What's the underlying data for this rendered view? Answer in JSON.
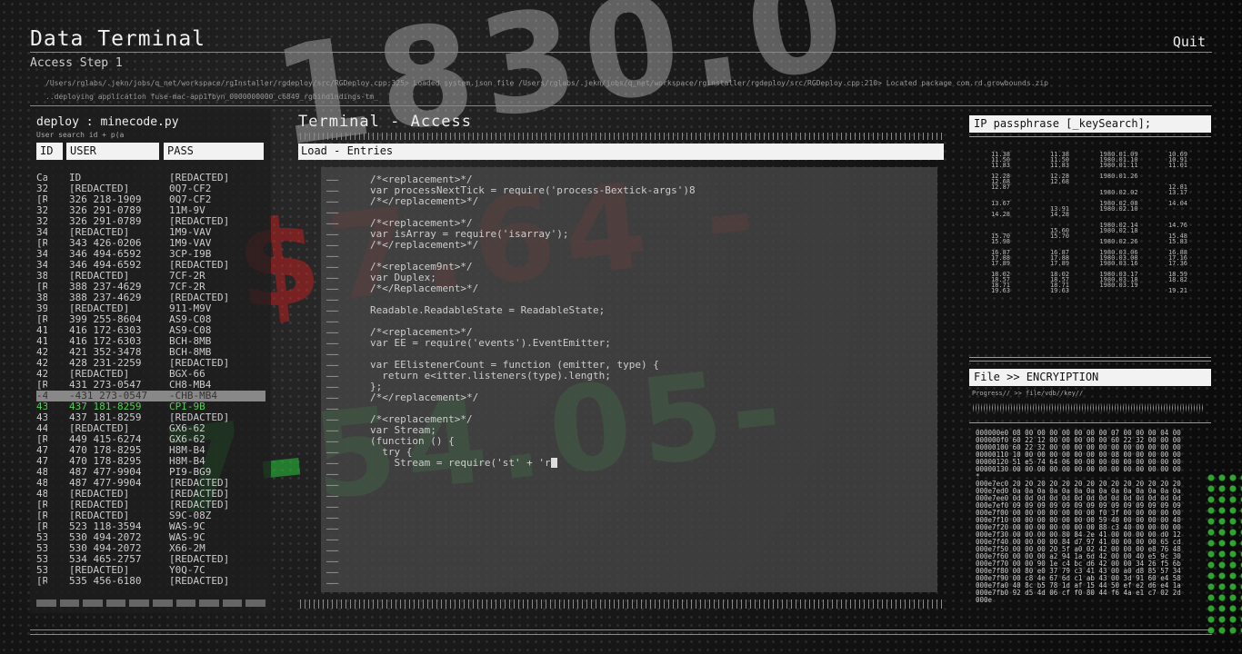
{
  "header": {
    "title": "Data Terminal",
    "quit": "Quit",
    "step": "Access Step 1",
    "path_1": "/Users/rglabs/.jekn/jobs/q_net/workspace/rgInstaller/rgdeploy/src/RGDeploy.cpp:325> Loaded system.json file /Users/rglabs/.jekn/jobs/q_net/workspace/rginstaller/rgdeploy/src/RGDeploy.cpp:210> Located package com.rd.growbounds.zip",
    "path_2": "..deploying application fuse-mac-app1fbyn_0000000000_c6849_rgbindindings-tm_"
  },
  "left_panel": {
    "title": "deploy : minecode.py",
    "subtitle": "User search id + p(a",
    "col_id": "ID",
    "col_user": "USER",
    "col_pass": "PASS",
    "rows": [
      [
        "Ca",
        "ID",
        "[REDACTED]"
      ],
      [
        "32",
        "[REDACTED]",
        "0Q7-CF2"
      ],
      [
        "[R",
        "326 218-1909",
        "0Q7-CF2"
      ],
      [
        "32",
        "326 291-0789",
        "11M-9V"
      ],
      [
        "32",
        "326 291-0789",
        "[REDACTED]"
      ],
      [
        "34",
        "[REDACTED]",
        "1M9-VAV"
      ],
      [
        "[R",
        "343 426-0206",
        "1M9-VAV"
      ],
      [
        "34",
        "346 494-6592",
        "3CP-I9B"
      ],
      [
        "34",
        "346 494-6592",
        "[REDACTED]"
      ],
      [
        "38",
        "[REDACTED]",
        "7CF-2R"
      ],
      [
        "[R",
        "388 237-4629",
        "7CF-2R"
      ],
      [
        "38",
        "388 237-4629",
        "[REDACTED]"
      ],
      [
        "39",
        "[REDACTED]",
        "911-M9V"
      ],
      [
        "[R",
        "399 255-8604",
        "AS9-C08"
      ],
      [
        "41",
        "416 172-6303",
        "AS9-C08"
      ],
      [
        "41",
        "416 172-6303",
        "BCH-8MB"
      ],
      [
        "42",
        "421 352-3478",
        "BCH-8MB"
      ],
      [
        "42",
        "428 231-2259",
        "[REDACTED]"
      ],
      [
        "42",
        "[REDACTED]",
        "BGX-66"
      ],
      [
        "[R",
        "431 273-0547",
        "CH8-MB4"
      ],
      [
        "-4",
        "-431 273-0547",
        "-CHB-MB4"
      ],
      [
        "43",
        "437 181-8259",
        "CPI-9B"
      ],
      [
        "43",
        "437 181-8259",
        "[REDACTED]"
      ],
      [
        "44",
        "[REDACTED]",
        "GX6-62"
      ],
      [
        "[R",
        "449 415-6274",
        "GX6-62"
      ],
      [
        "47",
        "470 178-8295",
        "H8M-B4"
      ],
      [
        "47",
        "470 178-8295",
        "H8M-B4"
      ],
      [
        "48",
        "487 477-9904",
        "PI9-BG9"
      ],
      [
        "48",
        "487 477-9904",
        "[REDACTED]"
      ],
      [
        "48",
        "[REDACTED]",
        "[REDACTED]"
      ],
      [
        "[R",
        "[REDACTED]",
        "[REDACTED]"
      ],
      [
        "[R",
        "[REDACTED]",
        "S9C-08Z"
      ],
      [
        "[R",
        "523 118-3594",
        "WAS-9C"
      ],
      [
        "53",
        "530 494-2072",
        "WAS-9C"
      ],
      [
        "53",
        "530 494-2072",
        "X66-2M"
      ],
      [
        "53",
        "534 465-2757",
        "[REDACTED]"
      ],
      [
        "53",
        "[REDACTED]",
        "Y0Q-7C"
      ],
      [
        "[R",
        "535 456-6180",
        "[REDACTED]"
      ]
    ]
  },
  "terminal": {
    "title": "Terminal - Access",
    "load_label": "Load - Entries",
    "gutter": "——",
    "lines": [
      "/*<replacement>*/",
      "var processNextTick = require('process-Bextick-args')8",
      "/*</replacement>*/",
      "",
      "/*<replacement>*/",
      "var isArray = require('isarray');",
      "/*</replacement>*/",
      "",
      "/*<replacem9nt>*/",
      "var Duplex;",
      "/*</Replacement>*/",
      "",
      "Readable.ReadableState = ReadableState;",
      "",
      "/*<replacement>*/",
      "var EE = require('events').EventEmitter;",
      "",
      "var EElistenerCount = function (emitter, type) {",
      "  return e<itter.listeners(type).length;",
      "};",
      "/*</replacement>*/",
      "",
      "/*<replacement>*/",
      "var Stream;",
      "(function () {",
      "  try {",
      "    Stream = require('st' + 'r",
      "",
      "",
      "",
      "",
      "",
      "",
      "",
      "",
      "",
      "",
      ""
    ]
  },
  "right_panel": {
    "ip_label": "IP passphrase [_keySearch];",
    "stats": [
      [
        "11.38",
        "11.38",
        "1980.01.09",
        "10.69"
      ],
      [
        "11.50",
        "11.50",
        "1980.01.10",
        "10.91"
      ],
      [
        "11.83",
        "11.83",
        "1980.01.11",
        "11.01"
      ],
      [
        "",
        "",
        "",
        ""
      ],
      [
        "12.28",
        "12.28",
        "1980.01.26",
        ""
      ],
      [
        "12.68",
        "12.68",
        "",
        ""
      ],
      [
        "12.87",
        "",
        "",
        "12.81"
      ],
      [
        "",
        "",
        "1980.02.02",
        "13.17"
      ],
      [
        "",
        "",
        "",
        ""
      ],
      [
        "13.67",
        "",
        "1980.02.08",
        "14.04"
      ],
      [
        "",
        "13.91",
        "1980.02.10",
        ""
      ],
      [
        "14.28",
        "14.28",
        "",
        ""
      ],
      [
        "",
        "",
        "",
        ""
      ],
      [
        "",
        "",
        "1980.02.14",
        "14.76"
      ],
      [
        "",
        "15.60",
        "1980.02.18",
        ""
      ],
      [
        "15.70",
        "15.70",
        "",
        "15.48"
      ],
      [
        "15.98",
        "",
        "1980.02.26",
        "15.83"
      ],
      [
        "",
        "",
        "",
        ""
      ],
      [
        "16.87",
        "16.87",
        "1980.03.06",
        "16.88"
      ],
      [
        "17.88",
        "17.88",
        "1980.03.08",
        "17.16"
      ],
      [
        "17.89",
        "17.89",
        "1980.03.16",
        "17.36"
      ],
      [
        "",
        "",
        "",
        ""
      ],
      [
        "18.02",
        "18.02",
        "1980.03.17",
        "18.59"
      ],
      [
        "18.57",
        "18.57",
        "1980.03.18",
        "18.82"
      ],
      [
        "18.71",
        "18.71",
        "1980.03.19",
        ""
      ],
      [
        "19.63",
        "19.63",
        "",
        "19.21"
      ]
    ],
    "enc_label": "File >> ENCRYIPTION",
    "enc_sub": "Progress//   >>   file/vdb//key//",
    "hex": [
      "000000e0  08 00 00 00 00 00 00 00  07 00 00 00 04 00",
      "000000f0  60 22 12 00 00 00 00 00  60 22 32 00 00 00",
      "00000100  60 22 32 00 00 00 00 00  00 00 00 00 00 00",
      "00000110  10 00 00 00 00 00 00 00  08 00 00 00 00 00",
      "00000120  51 e5 74 64 06 00 00 00  00 00 00 00 00 00",
      "00000130  00 00 00 00 00 00 00 00  00 00 00 00 00 00",
      "*",
      "000e7ec0  20 20 20 20 20 20 20 20  20 20 20 20 20 20",
      "000e7ed0  0a 0a 0a 0a 0a 0a 0a 0a  0a 0a 0a 0a 0a 0a",
      "000e7ee0  0d 0d 0d 0d 0d 0d 0d 0d  0d 0d 0d 0d 0d 0d",
      "000e7ef0  09 09 09 09 09 09 09 09  09 09 09 09 09 09",
      "000e7f00  00 00 00 00 00 00 00 f0  3f 00 00 00 00 00",
      "000e7f10  00 00 00 00 00 00 00 59  40 00 00 00 00 40",
      "000e7f20  00 00 00 00 00 00 00 88  c3 40 00 00 00 00",
      "000e7f30  00 00 00 00 80 84 2e 41  00 00 00 00 d0 12",
      "000e7f40  00 00 00 00 84 d7 97 41  00 00 00 00 65 cd",
      "000e7f50  00 00 00 20 5f a0 02 42  00 00 00 e8 76 48",
      "000e7f60  00 00 00 a2 94 1a 6d 42  00 00 40 e5 9c 30",
      "000e7f70  00 00 90 1e c4 bc d6 42  00 00 34 26 f5 6b",
      "000e7f80  00 80 e0 37 79 c3 41 43  00 a0 d8 85 57 34",
      "000e7f90  00 c8 4e 67 6d c1 ab 43  00 3d 91 60 e4 58",
      "000e7fa0  40 8c b5 78 1d af 15 44  50 ef e2 d6 e4 1a",
      "000e7fb0  92 d5 4d 06 cf f0 80 44  f6 4a e1 c7 02 2d",
      "000e"
    ]
  }
}
